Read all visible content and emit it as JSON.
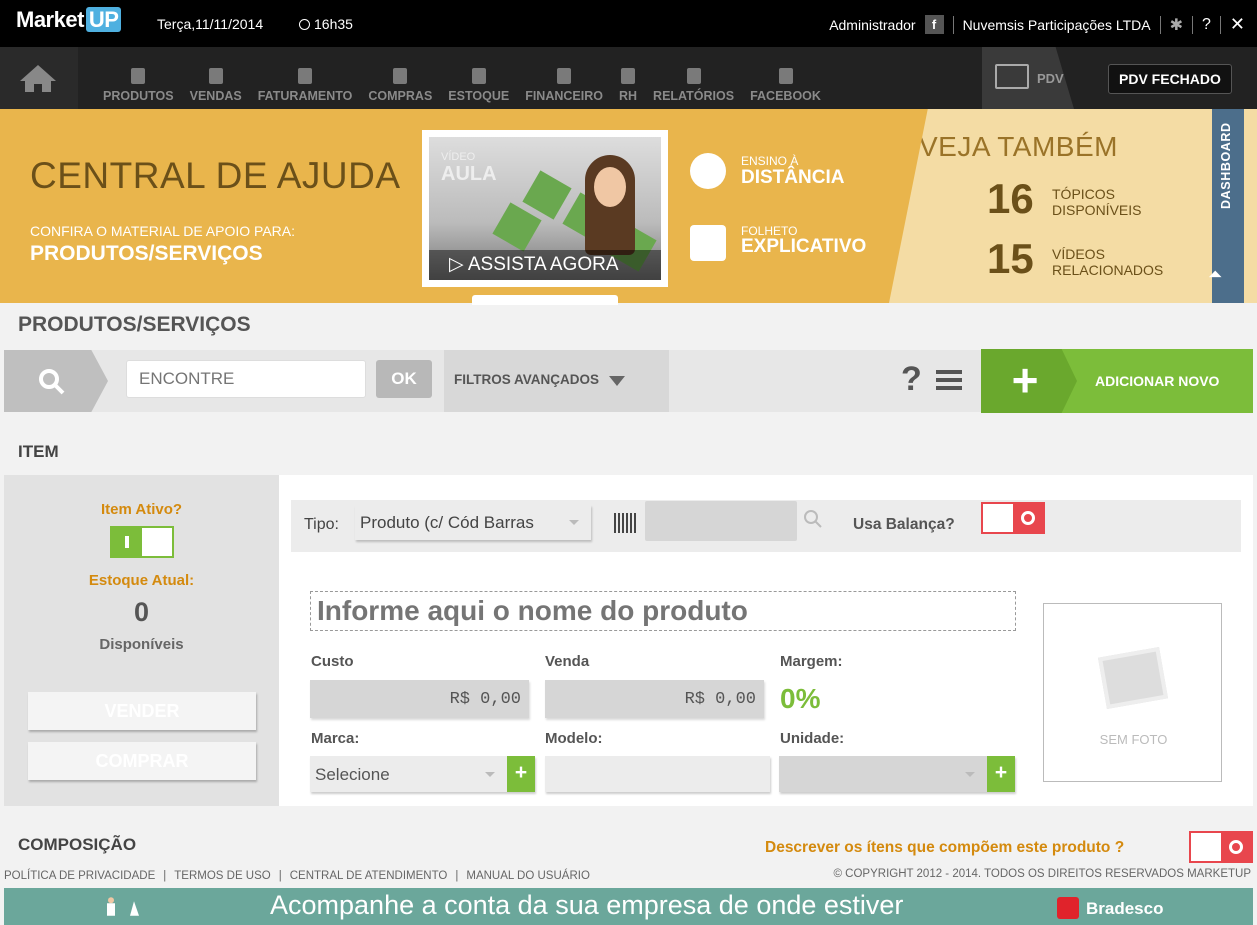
{
  "topbar": {
    "logo_main": "Market",
    "logo_up": "UP",
    "date": "Terça,11/11/2014",
    "time": "16h35",
    "user": "Administrador",
    "facebook_glyph": "f",
    "company": "Nuvemsis Participações LTDA",
    "help": "?"
  },
  "nav": {
    "items": [
      {
        "label": "PRODUTOS",
        "icon": "barcode-icon"
      },
      {
        "label": "VENDAS",
        "icon": "tag-icon"
      },
      {
        "label": "FATURAMENTO",
        "icon": "money-bag-icon"
      },
      {
        "label": "COMPRAS",
        "icon": "basket-icon"
      },
      {
        "label": "ESTOQUE",
        "icon": "stock-icon"
      },
      {
        "label": "FINANCEIRO",
        "icon": "calculator-icon"
      },
      {
        "label": "RH",
        "icon": "person-icon"
      },
      {
        "label": "RELATÓRIOS",
        "icon": "chart-icon"
      },
      {
        "label": "FACEBOOK",
        "icon": "facebook-icon"
      }
    ],
    "pdv_label": "PDV",
    "pdv_status": "PDV FECHADO"
  },
  "banner": {
    "title": "CENTRAL DE AJUDA",
    "subtitle": "CONFIRA O MATERIAL DE APOIO PARA:",
    "section": "PRODUTOS/SERVIÇOS",
    "video_top": "VÍDEO",
    "video_bottom": "AULA",
    "video_play": "ASSISTA AGORA",
    "link1_small": "ENSINO À",
    "link1_big": "DISTÂNCIA",
    "link2_small": "FOLHETO",
    "link2_big": "EXPLICATIVO",
    "see_also_title": "VEJA TAMBÉM",
    "topics_count": "16",
    "topics_l1": "TÓPICOS",
    "topics_l2": "DISPONÍVEIS",
    "videos_count": "15",
    "videos_l1": "VÍDEOS",
    "videos_l2": "RELACIONADOS",
    "dashboard_tab": "DASHBOARD"
  },
  "page_title": "PRODUTOS/SERVIÇOS",
  "search": {
    "placeholder": "ENCONTRE",
    "ok": "OK",
    "filters": "FILTROS AVANÇADOS",
    "help": "?",
    "add_symbol": "+",
    "add_label": "ADICIONAR NOVO"
  },
  "item": {
    "heading": "ITEM",
    "active_label": "Item Ativo?",
    "stock_label": "Estoque Atual:",
    "stock_value": "0",
    "available_label": "Disponíveis",
    "sell_button": "VENDER",
    "buy_button": "COMPRAR",
    "type_label": "Tipo:",
    "type_value": "Produto (c/ Cód Barras",
    "scale_label": "Usa Balança?",
    "name_placeholder": "Informe aqui o nome do produto",
    "cost_label": "Custo",
    "cost_value": "R$ 0,00",
    "sale_label": "Venda",
    "sale_value": "R$ 0,00",
    "margin_label": "Margem:",
    "margin_value": "0%",
    "brand_label": "Marca:",
    "brand_value": "Selecione",
    "model_label": "Modelo:",
    "unit_label": "Unidade:",
    "plus": "+",
    "no_photo": "SEM FOTO"
  },
  "composition": {
    "title": "COMPOSIÇÃO",
    "question": "Descrever os ítens que compõem este produto ?"
  },
  "footer": {
    "links": [
      "POLÍTICA DE PRIVACIDADE",
      "TERMOS DE USO",
      "CENTRAL DE ATENDIMENTO",
      "MANUAL DO USUÁRIO"
    ],
    "copyright": "© COPYRIGHT 2012 - 2014. TODOS OS DIREITOS RESERVADOS MARKETUP"
  },
  "ad": {
    "text": "Acompanhe a conta da sua empresa de onde estiver",
    "brand": "Bradesco"
  },
  "colors": {
    "accent_green": "#7cbd3a",
    "banner_gold": "#e9b54c",
    "toggle_red": "#e8464d",
    "label_orange": "#d48a0e"
  }
}
